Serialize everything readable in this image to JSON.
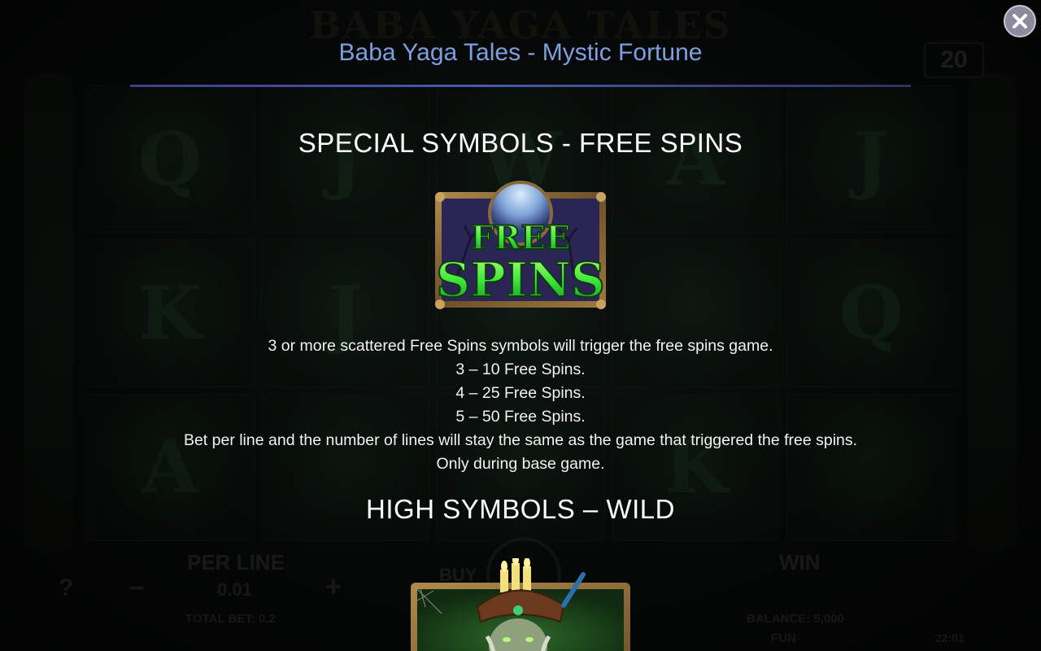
{
  "window": {
    "title": "Baba Yaga Tales - Mystic Fortune"
  },
  "icons": {
    "close": "close-icon",
    "free_spins_symbol": "free-spins-symbol-icon",
    "wild_symbol": "baba-yaga-wild-symbol-icon"
  },
  "colors": {
    "title": "#7d9fe0",
    "divider": "#4a5aa8",
    "heading": "#ffffff",
    "body_text": "#f2f2f2",
    "free_spins_green": "#41e63c"
  },
  "sections": {
    "free_spins": {
      "heading": "SPECIAL SYMBOLS - FREE SPINS",
      "symbol_text_line1": "FREE",
      "symbol_text_line2": "SPINS",
      "lines": [
        "3 or more scattered Free Spins symbols will trigger the free spins game.",
        "3 – 10 Free Spins.",
        "4 – 25 Free Spins.",
        "5 – 50 Free Spins.",
        "Bet per line and the number of lines will stay the same as the game that triggered the free spins.",
        "Only during base game."
      ]
    },
    "wild": {
      "heading": "HIGH SYMBOLS – WILD"
    }
  },
  "background_game": {
    "logo": "BABA YAGA TALES",
    "lines_count": "20",
    "per_line_label": "PER LINE",
    "per_line_value": "0.01",
    "total_bet": "TOTAL BET: 0.2",
    "buy_label": "BUY",
    "win_label": "WIN",
    "balance": "BALANCE: 5,000",
    "fun_label": "FUN",
    "clock": "22:01",
    "reel_symbols": [
      "Q",
      "J",
      "W",
      "A",
      "J",
      "K",
      "J",
      "",
      "",
      "Q",
      "A",
      "",
      "",
      "K",
      ""
    ]
  }
}
